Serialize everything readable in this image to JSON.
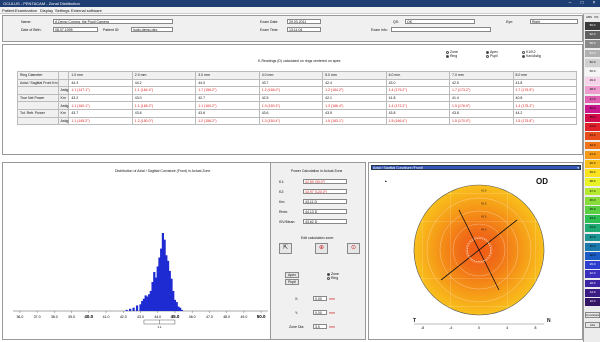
{
  "window": {
    "title": "OCULUS - PENTACAM - Zonal Distribution"
  },
  "menubar": [
    "Patient",
    "Examination",
    "Display",
    "Settings",
    "External software"
  ],
  "patient": {
    "name_label": "Name:",
    "name_value": "A Demo Cornea, the Pupil Camera",
    "dob_label": "Date of Birth:",
    "dob_value": "08.07.1995",
    "patient_id_label": "Patient ID:",
    "patient_id_value": "Isotp-demo-dec",
    "exam_date_label": "Exam Date:",
    "exam_date_value": "29.03.2011",
    "exam_time_label": "Exam Time:",
    "exam_time_value": "13:11:04",
    "exam_info_label": "Exam Info:",
    "exam_info_value": "",
    "qs_label": "QS:",
    "qs_value": "OK",
    "eye_label": "Eye:",
    "eye_value": "Right"
  },
  "readings": {
    "caption": "K-Readings (D) calculated on rings centered on apex:",
    "zone_options": [
      {
        "label": "Zone",
        "checked": false
      },
      {
        "label": "Ring",
        "checked": true
      }
    ],
    "center_options": [
      {
        "label": "Apex",
        "checked": true
      },
      {
        "label": "Pupil",
        "checked": false
      }
    ],
    "k_options": [
      {
        "label": "K1/K2",
        "checked": false
      },
      {
        "label": "Kav/Astig",
        "checked": true
      }
    ],
    "header": [
      "Ring Diameter",
      "",
      "1.0 mm",
      "2.0 mm",
      "3.0 mm",
      "4.0 mm",
      "5.0 mm",
      "6.0 mm",
      "7.0 mm",
      "8.0 mm"
    ],
    "rows": [
      {
        "label": "Axial / Sagittal Front Km",
        "sub": "",
        "values": [
          "44.3",
          "44.2",
          "44.0",
          "43.7",
          "42.4",
          "43.0",
          "42.5",
          "41.8"
        ],
        "red": false
      },
      {
        "label": "",
        "sub": "Astig",
        "values": [
          "1.1  (147.1°)",
          "1.1  (164.4°)",
          "1.7  (156.2°)",
          "1.2  (166.0°)",
          "1.2  (164.2°)",
          "1.4  (179.2°)",
          "1.7  (173.2°)",
          "1.7  (176.5°)"
        ],
        "red": true
      },
      {
        "label": "True Net Power",
        "sub": "Km",
        "values": [
          "43.2",
          "43.0",
          "42.7",
          "42.5",
          "42.1",
          "41.8",
          "41.4",
          "40.8"
        ],
        "red": false
      },
      {
        "label": "",
        "sub": "Astig",
        "values": [
          "1.1  (160.1°)",
          "1.1  (165.2°)",
          "1.1  (160.2°)",
          "1.3  (150.3°)",
          "1.3  (166.4°)",
          "1.4  (172.2°)",
          "1.5  (176.9°)",
          "1.4  (175.2°)"
        ],
        "red": true
      },
      {
        "label": "Tot. Refr. Power",
        "sub": "Km",
        "values": [
          "43.7",
          "43.6",
          "43.6",
          "43.6",
          "43.5",
          "43.8",
          "43.8",
          "44.2"
        ],
        "red": false
      },
      {
        "label": "",
        "sub": "Astig",
        "values": [
          "1.1  (145.2°)",
          "1.2  (150.0°)",
          "1.2  (156.2°)",
          "1.3  (150.4°)",
          "1.5  (163.1°)",
          "1.5  (166.4°)",
          "1.5  (170.0°)",
          "1.5  (175.8°)"
        ],
        "red": true
      }
    ]
  },
  "distribution": {
    "title": "Distribution of Axial / Sagittal Curvature (Front) in Actual Zone",
    "x_ticks": [
      "36.0",
      "37.0",
      "38.0",
      "39.0",
      "40.0",
      "41.0",
      "42.0",
      "43.0",
      "44.0",
      "45.0",
      "46.0",
      "47.0",
      "48.0",
      "49.0",
      "50.0"
    ],
    "bold_ticks": [
      "40.0",
      "45.0",
      "50.0"
    ],
    "box_labels": [
      "1.1",
      "43.5",
      "44.8"
    ]
  },
  "chart_data": {
    "type": "bar",
    "title": "Distribution of Axial / Sagittal Curvature (Front) in Actual Zone",
    "xlabel": "",
    "ylabel": "",
    "xlim": [
      35.6,
      50.4
    ],
    "categories": [
      "42.2",
      "42.4",
      "42.6",
      "42.8",
      "43.0",
      "43.1",
      "43.2",
      "43.3",
      "43.4",
      "43.5",
      "43.6",
      "43.7",
      "43.8",
      "43.9",
      "44.0",
      "44.1",
      "44.2",
      "44.3",
      "44.4",
      "44.5",
      "44.6",
      "44.7",
      "44.8",
      "44.9",
      "45.0",
      "45.1",
      "45.2",
      "45.3",
      "45.4"
    ],
    "values": [
      1,
      2,
      3,
      5,
      6,
      9,
      11,
      14,
      13,
      15,
      18,
      26,
      35,
      30,
      40,
      48,
      56,
      70,
      64,
      50,
      45,
      36,
      29,
      18,
      10,
      8,
      4,
      3,
      1
    ]
  },
  "power_calc": {
    "title": "Power Calculation in Actual Zone",
    "fields": [
      {
        "label": "K1:",
        "value": "42.59 (30.0°)",
        "red": true
      },
      {
        "label": "K2:",
        "value": "43.97 (120.0°)",
        "red": true
      },
      {
        "label": "Km:",
        "value": "43.11 D",
        "red": false
      },
      {
        "label": "Rmin:",
        "value": "44.13 D",
        "red": false
      },
      {
        "label": "ISV/Mean:",
        "value": "43.62 D",
        "red": false
      }
    ],
    "edit_zone_label": "Edit calculation zone:",
    "apex_label": "Apex",
    "pupil_label": "Pupil",
    "zone_label": "Zone",
    "ring_label": "Ring",
    "x_label": "X:",
    "x_value": "0.00",
    "y_label": "Y:",
    "y_value": "0.00",
    "dia_label": "Zone Dia:",
    "dia_value": "3.0",
    "unit": "mm"
  },
  "map": {
    "dropdown_value": "Axial / Sagittal Curvature (Front)",
    "eye_label": "OD",
    "axis_labels": [
      "-8",
      "-4",
      "0",
      "4",
      "8"
    ],
    "temporal_label": "T",
    "nasal_label": "N",
    "ring_labels": [
      "44.0",
      "43.5",
      "42.5",
      "41.5"
    ]
  },
  "colorscale": {
    "top_labels": [
      "ABS",
      "OS"
    ],
    "values": [
      "66.0",
      "62.0",
      "58.0",
      "54.0",
      "52.0",
      "50.0",
      "49.0",
      "48.0",
      "47.0",
      "46.0",
      "45.0",
      "44.0",
      "43.0",
      "42.0",
      "41.0",
      "40.0",
      "39.0",
      "38.0",
      "37.0",
      "36.0",
      "35.0",
      "34.0",
      "33.0",
      "32.0",
      "30.0",
      "28.0",
      "26.0",
      "22.0",
      "18.0",
      "14.0",
      "10.0"
    ],
    "colors": [
      "#3a3a3a",
      "#606060",
      "#8a8a8a",
      "#b0b0b0",
      "#d0d0d0",
      "#f5f5f5",
      "#f6d2e8",
      "#ee9ccd",
      "#e05fb0",
      "#c9178c",
      "#d10b4a",
      "#e0202a",
      "#e84c1c",
      "#f07419",
      "#f69a17",
      "#f8bf1a",
      "#fbe31f",
      "#e8f224",
      "#b7e830",
      "#88dc39",
      "#59cf41",
      "#2dbf52",
      "#20aa73",
      "#1f9593",
      "#1c79ad",
      "#1a5cc4",
      "#2e3fd0",
      "#3b2fbd",
      "#3d25a1",
      "#3a1c84",
      "#351566"
    ],
    "bottom_labels": [
      "Curvature",
      "Abs"
    ]
  }
}
